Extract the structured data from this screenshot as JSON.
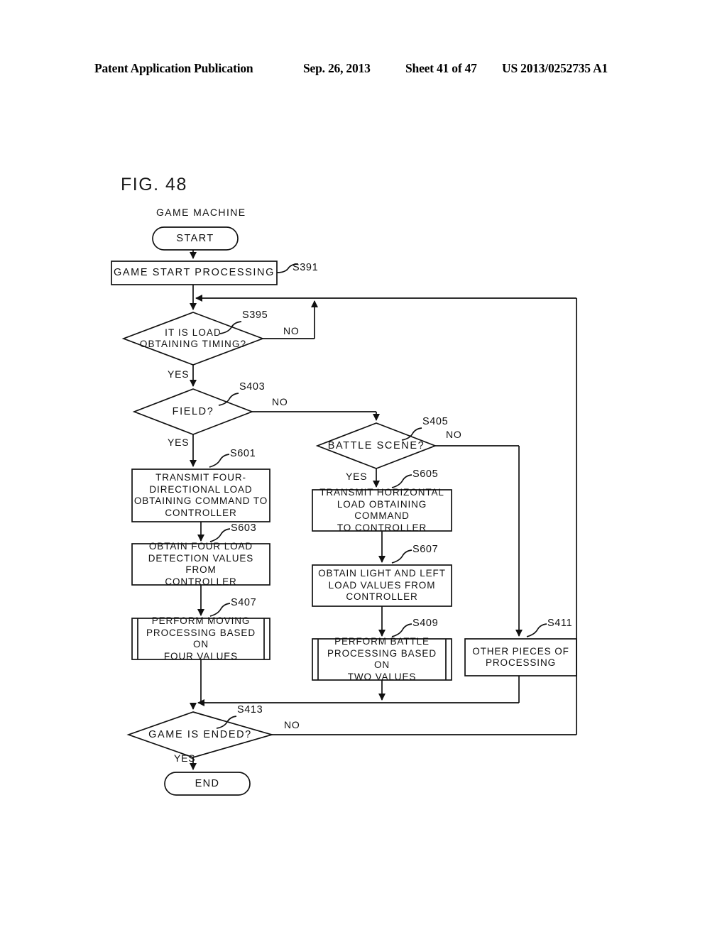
{
  "header": {
    "publication": "Patent Application Publication",
    "date": "Sep. 26, 2013",
    "sheet": "Sheet 41 of 47",
    "patent_number": "US 2013/0252735 A1"
  },
  "figure": {
    "label": "FIG. 48",
    "swimlane_caption": "GAME MACHINE"
  },
  "chart_data": {
    "type": "diagram",
    "diagram_type": "flowchart",
    "title": "FIG. 48",
    "nodes": [
      {
        "id": "start",
        "shape": "terminator",
        "text": "START",
        "step": ""
      },
      {
        "id": "s391",
        "shape": "process",
        "text": "GAME START PROCESSING",
        "step": "S391"
      },
      {
        "id": "s395",
        "shape": "decision",
        "text": "IT IS LOAD OBTAINING TIMING?",
        "step": "S395"
      },
      {
        "id": "s403",
        "shape": "decision",
        "text": "FIELD?",
        "step": "S403"
      },
      {
        "id": "s405",
        "shape": "decision",
        "text": "BATTLE SCENE?",
        "step": "S405"
      },
      {
        "id": "s601",
        "shape": "process",
        "text": "TRANSMIT FOUR-DIRECTIONAL LOAD OBTAINING COMMAND TO CONTROLLER",
        "step": "S601"
      },
      {
        "id": "s603",
        "shape": "process",
        "text": "OBTAIN FOUR LOAD DETECTION VALUES FROM CONTROLLER",
        "step": "S603"
      },
      {
        "id": "s407",
        "shape": "subroutine",
        "text": "PERFORM MOVING PROCESSING BASED ON FOUR VALUES",
        "step": "S407"
      },
      {
        "id": "s605",
        "shape": "process",
        "text": "TRANSMIT HORIZONTAL LOAD OBTAINING COMMAND TO CONTROLLER",
        "step": "S605"
      },
      {
        "id": "s607",
        "shape": "process",
        "text": "OBTAIN LIGHT AND LEFT LOAD VALUES FROM CONTROLLER",
        "step": "S607"
      },
      {
        "id": "s409",
        "shape": "subroutine",
        "text": "PERFORM BATTLE PROCESSING BASED ON TWO VALUES",
        "step": "S409"
      },
      {
        "id": "s411",
        "shape": "process",
        "text": "OTHER PIECES OF PROCESSING",
        "step": "S411"
      },
      {
        "id": "s413",
        "shape": "decision",
        "text": "GAME IS ENDED?",
        "step": "S413"
      },
      {
        "id": "end",
        "shape": "terminator",
        "text": "END",
        "step": ""
      }
    ],
    "edges": [
      {
        "from": "start",
        "to": "s391",
        "label": ""
      },
      {
        "from": "s391",
        "to": "s395",
        "label": ""
      },
      {
        "from": "s395",
        "to": "s403",
        "label": "YES"
      },
      {
        "from": "s395",
        "to": "s395",
        "label": "NO"
      },
      {
        "from": "s403",
        "to": "s601",
        "label": "YES"
      },
      {
        "from": "s403",
        "to": "s405",
        "label": "NO"
      },
      {
        "from": "s405",
        "to": "s605",
        "label": "YES"
      },
      {
        "from": "s405",
        "to": "s411",
        "label": "NO"
      },
      {
        "from": "s601",
        "to": "s603",
        "label": ""
      },
      {
        "from": "s603",
        "to": "s407",
        "label": ""
      },
      {
        "from": "s407",
        "to": "s413",
        "label": ""
      },
      {
        "from": "s605",
        "to": "s607",
        "label": ""
      },
      {
        "from": "s607",
        "to": "s409",
        "label": ""
      },
      {
        "from": "s409",
        "to": "s413",
        "label": ""
      },
      {
        "from": "s411",
        "to": "s413",
        "label": ""
      },
      {
        "from": "s413",
        "to": "end",
        "label": "YES"
      },
      {
        "from": "s413",
        "to": "s395",
        "label": "NO"
      }
    ]
  },
  "nodes": {
    "start": {
      "text": "START"
    },
    "s391": {
      "text": "GAME START PROCESSING",
      "step": "S391"
    },
    "s395": {
      "line1": "IT IS LOAD",
      "line2": "OBTAINING TIMING?",
      "step": "S395",
      "yes": "YES",
      "no": "NO"
    },
    "s403": {
      "text": "FIELD?",
      "step": "S403",
      "yes": "YES",
      "no": "NO"
    },
    "s405": {
      "text": "BATTLE SCENE?",
      "step": "S405",
      "yes": "YES",
      "no": "NO"
    },
    "s601": {
      "line1": "TRANSMIT FOUR-",
      "line2": "DIRECTIONAL LOAD",
      "line3": "OBTAINING COMMAND TO",
      "line4": "CONTROLLER",
      "step": "S601"
    },
    "s603": {
      "line1": "OBTAIN FOUR LOAD",
      "line2": "DETECTION VALUES FROM",
      "line3": "CONTROLLER",
      "step": "S603"
    },
    "s407": {
      "line1": "PERFORM MOVING",
      "line2": "PROCESSING BASED ON",
      "line3": "FOUR VALUES",
      "step": "S407"
    },
    "s605": {
      "line1": "TRANSMIT HORIZONTAL",
      "line2": "LOAD OBTAINING COMMAND",
      "line3": "TO CONTROLLER",
      "step": "S605"
    },
    "s607": {
      "line1": "OBTAIN LIGHT AND LEFT",
      "line2": "LOAD VALUES FROM",
      "line3": "CONTROLLER",
      "step": "S607"
    },
    "s409": {
      "line1": "PERFORM BATTLE",
      "line2": "PROCESSING BASED ON",
      "line3": "TWO VALUES",
      "step": "S409"
    },
    "s411": {
      "line1": "OTHER PIECES OF",
      "line2": "PROCESSING",
      "step": "S411"
    },
    "s413": {
      "text": "GAME IS ENDED?",
      "step": "S413",
      "yes": "YES",
      "no": "NO"
    },
    "end": {
      "text": "END"
    }
  },
  "colors": {
    "ink": "#111111",
    "paper": "#ffffff"
  }
}
